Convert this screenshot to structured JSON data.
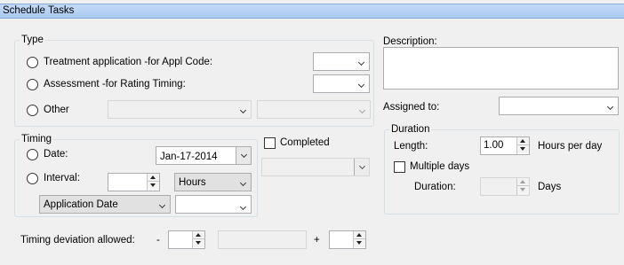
{
  "window": {
    "title": "Schedule Tasks"
  },
  "type_group": {
    "legend": "Type",
    "treatment_label": "Treatment application -for Appl Code:",
    "assessment_label": "Assessment -for Rating Timing:",
    "other_label": "Other"
  },
  "description": {
    "label": "Description:",
    "value": ""
  },
  "assigned_to": {
    "label": "Assigned to:",
    "value": ""
  },
  "timing": {
    "legend": "Timing",
    "date_label": "Date:",
    "date_value": "Jan-17-2014",
    "interval_label": "Interval:",
    "interval_value": "",
    "interval_unit": "Hours",
    "reference": "Application Date"
  },
  "completed": {
    "label": "Completed"
  },
  "duration": {
    "legend": "Duration",
    "length_label": "Length:",
    "length_value": "1.00",
    "hours_per_day_label": "Hours per day",
    "multiple_days_label": "Multiple days",
    "duration_label": "Duration:",
    "days_label": "Days"
  },
  "deviation": {
    "label": "Timing deviation allowed:",
    "minus": "-",
    "plus": "+"
  }
}
